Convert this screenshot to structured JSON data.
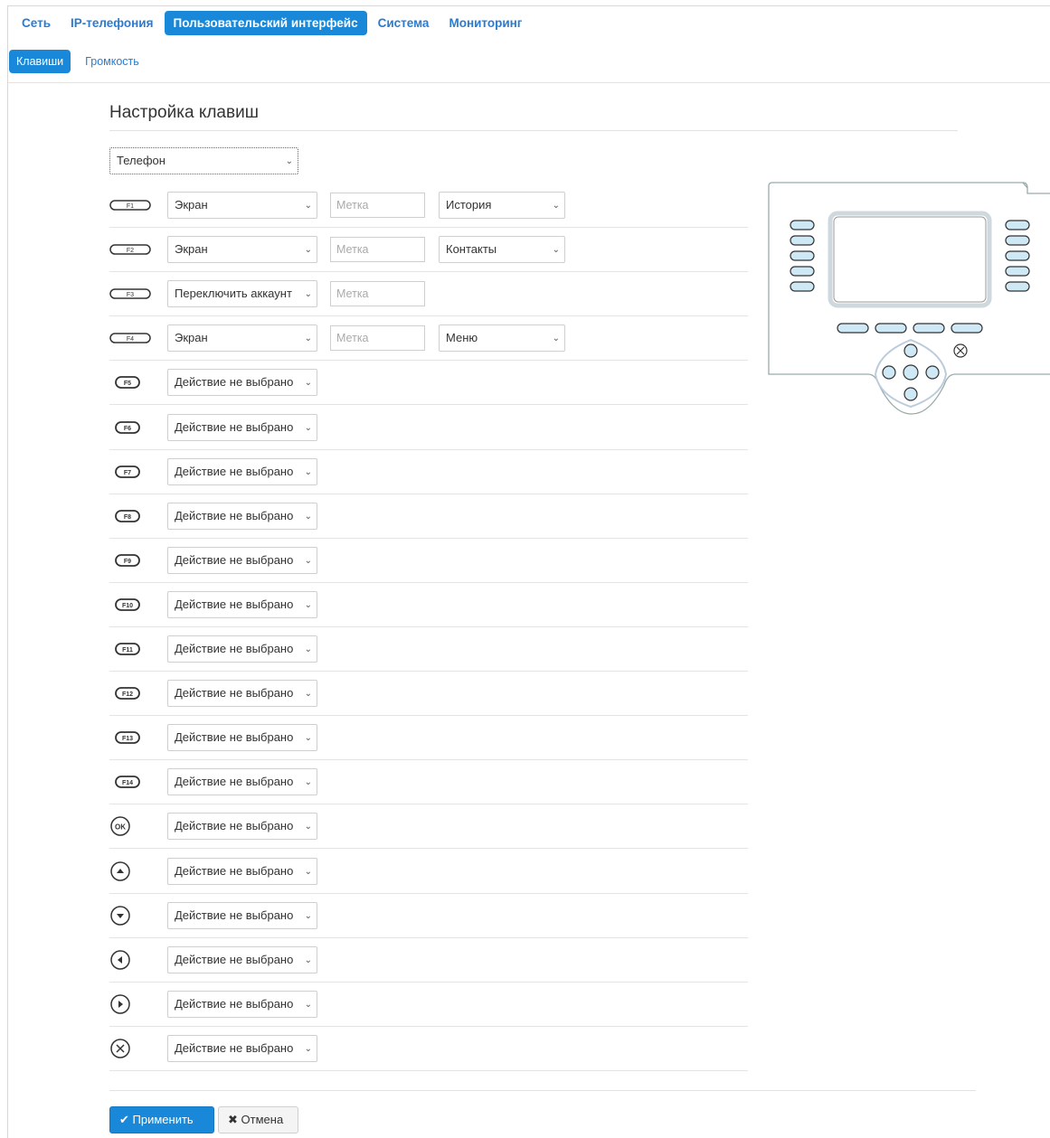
{
  "top_tabs": [
    "Сеть",
    "IP-телефония",
    "Пользовательский интерфейс",
    "Система",
    "Мониторинг"
  ],
  "sub_tabs": [
    "Клавиши",
    "Громкость"
  ],
  "page_title": "Настройка клавиш",
  "device_select": "Телефон",
  "label_placeholder": "Метка",
  "rows": [
    {
      "key": "F1",
      "action": "Экран",
      "target": "История"
    },
    {
      "key": "F2",
      "action": "Экран",
      "target": "Контакты"
    },
    {
      "key": "F3",
      "action": "Переключить аккаунт",
      "target": ""
    },
    {
      "key": "F4",
      "action": "Экран",
      "target": "Меню"
    },
    {
      "key": "F5",
      "action": "Действие не выбрано"
    },
    {
      "key": "F6",
      "action": "Действие не выбрано"
    },
    {
      "key": "F7",
      "action": "Действие не выбрано"
    },
    {
      "key": "F8",
      "action": "Действие не выбрано"
    },
    {
      "key": "F9",
      "action": "Действие не выбрано"
    },
    {
      "key": "F10",
      "action": "Действие не выбрано"
    },
    {
      "key": "F11",
      "action": "Действие не выбрано"
    },
    {
      "key": "F12",
      "action": "Действие не выбрано"
    },
    {
      "key": "F13",
      "action": "Действие не выбрано"
    },
    {
      "key": "F14",
      "action": "Действие не выбрано"
    },
    {
      "key": "OK",
      "action": "Действие не выбрано"
    },
    {
      "key": "Up",
      "action": "Действие не выбрано"
    },
    {
      "key": "Down",
      "action": "Действие не выбрано"
    },
    {
      "key": "Left",
      "action": "Действие не выбрано"
    },
    {
      "key": "Right",
      "action": "Действие не выбрано"
    },
    {
      "key": "Cancel",
      "action": "Действие не выбрано"
    }
  ],
  "buttons": {
    "apply": "Применить",
    "cancel": "Отмена"
  },
  "icons": {
    "apply": "check-icon",
    "cancel": "close-icon"
  },
  "colors": {
    "accent": "#1a88d8",
    "link": "#2a7bd0",
    "keycap_fill": "#cfe8f5"
  }
}
